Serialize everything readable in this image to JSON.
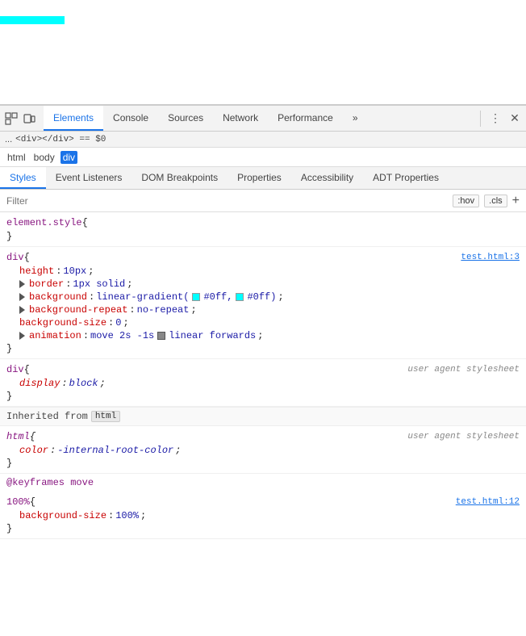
{
  "preview": {
    "bar_color": "#00ffff"
  },
  "toolbar": {
    "inspect_icon": "⊡",
    "device_icon": "▭",
    "tabs": [
      {
        "label": "Elements",
        "active": true
      },
      {
        "label": "Console",
        "active": false
      },
      {
        "label": "Sources",
        "active": false
      },
      {
        "label": "Network",
        "active": false
      },
      {
        "label": "Performance",
        "active": false
      },
      {
        "label": "»",
        "active": false
      }
    ],
    "more_icon": "⋮",
    "close_icon": "✕"
  },
  "breadcrumb": {
    "ellipsis": "...",
    "code": "<div></div> == $0"
  },
  "dom_path": {
    "items": [
      "html",
      "body",
      "div"
    ]
  },
  "styles_tabs": {
    "items": [
      {
        "label": "Styles",
        "active": true
      },
      {
        "label": "Event Listeners",
        "active": false
      },
      {
        "label": "DOM Breakpoints",
        "active": false
      },
      {
        "label": "Properties",
        "active": false
      },
      {
        "label": "Accessibility",
        "active": false
      },
      {
        "label": "ADT Properties",
        "active": false
      }
    ]
  },
  "filter": {
    "placeholder": "Filter",
    "hov_label": ":hov",
    "cls_label": ".cls",
    "add_label": "+"
  },
  "style_blocks": [
    {
      "selector": "element.style",
      "brace_open": " {",
      "source": "",
      "props": [],
      "brace_close": "}"
    },
    {
      "selector": "div",
      "brace_open": " {",
      "source": "test.html:3",
      "props": [
        {
          "name": "height",
          "colon": ":",
          "value": " 10px",
          "semi": ";"
        },
        {
          "name": "border",
          "colon": ":",
          "value": " 1px solid",
          "semi": ";",
          "has_arrow": true
        },
        {
          "name": "background",
          "colon": ":",
          "value": " linear-gradient(",
          "semi": ";",
          "has_color1": true,
          "has_color2": true,
          "color1": "#00ffff",
          "color2": "#00ffff",
          "value_after": "#0ff,",
          "value_end": "#0ff);",
          "is_gradient": true
        },
        {
          "name": "background-repeat",
          "colon": ":",
          "value": " no-repeat",
          "semi": ";",
          "has_arrow": true
        },
        {
          "name": "background-size",
          "colon": ":",
          "value": " 0",
          "semi": ";"
        },
        {
          "name": "animation",
          "colon": ":",
          "value": " move 2s -1s",
          "semi": ";",
          "has_checkbox": true,
          "value_end": "linear forwards;"
        }
      ],
      "brace_close": "}"
    },
    {
      "selector": "div",
      "brace_open": " {",
      "source": "user agent stylesheet",
      "source_italic": true,
      "props": [
        {
          "name": "display",
          "colon": ":",
          "value": " block",
          "semi": ";",
          "italic": true
        }
      ],
      "brace_close": "}"
    },
    {
      "type": "inherited",
      "label": "Inherited from",
      "tag": "html"
    },
    {
      "selector": "html",
      "brace_open": " {",
      "source": "user agent stylesheet",
      "source_italic": true,
      "props": [
        {
          "name": "color",
          "colon": ":",
          "value": " -internal-root-color",
          "semi": ";",
          "italic": true
        }
      ],
      "brace_close": "}"
    },
    {
      "type": "keyframes",
      "label": "@keyframes move"
    },
    {
      "selector": "100%",
      "brace_open": " {",
      "source": "test.html:12",
      "props": [
        {
          "name": "background-size",
          "colon": ":",
          "value": " 100%",
          "semi": ";"
        }
      ],
      "brace_close": "}"
    }
  ]
}
